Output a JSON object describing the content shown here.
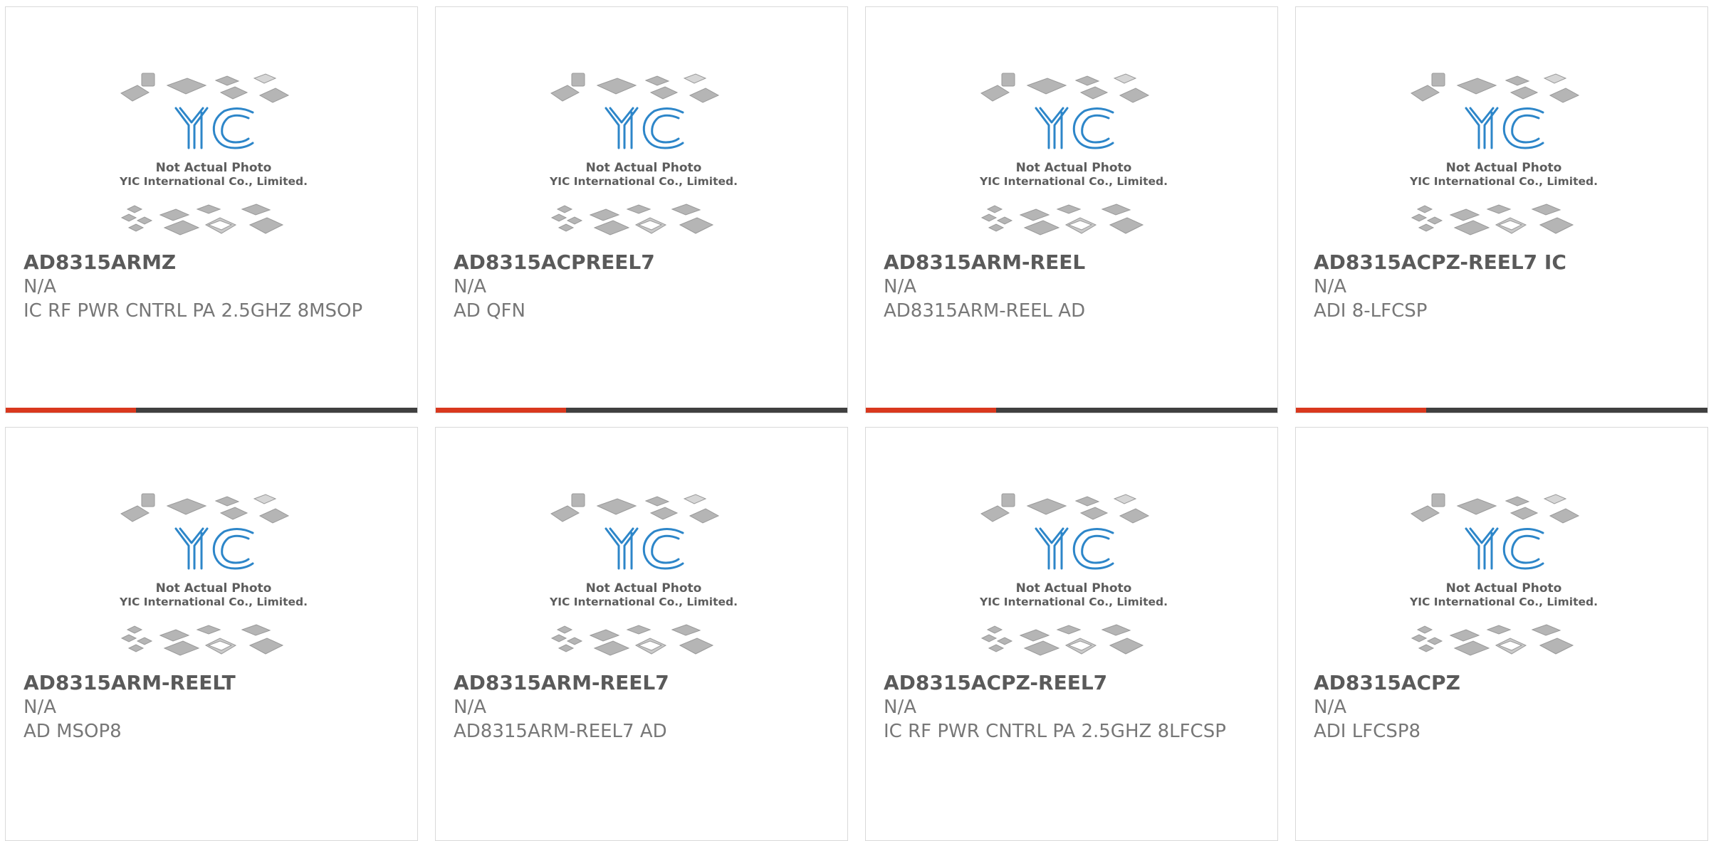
{
  "placeholder_image": {
    "line1": "Not Actual Photo",
    "line2": "YIC International Co., Limited.",
    "logo_text": "YIC"
  },
  "colors": {
    "accent": "#d9381e",
    "bar": "#404040",
    "logo": "#2d86c9"
  },
  "products": [
    {
      "part_number": "AD8315ARMZ",
      "manufacturer": "N/A",
      "description": "IC RF PWR CNTRL PA 2.5GHZ 8MSOP"
    },
    {
      "part_number": "AD8315ACPREEL7",
      "manufacturer": "N/A",
      "description": "AD QFN"
    },
    {
      "part_number": "AD8315ARM-REEL",
      "manufacturer": "N/A",
      "description": "AD8315ARM-REEL AD"
    },
    {
      "part_number": "AD8315ACPZ-REEL7 IC",
      "manufacturer": "N/A",
      "description": "ADI 8-LFCSP"
    },
    {
      "part_number": "AD8315ARM-REELT",
      "manufacturer": "N/A",
      "description": "AD MSOP8"
    },
    {
      "part_number": "AD8315ARM-REEL7",
      "manufacturer": "N/A",
      "description": "AD8315ARM-REEL7 AD"
    },
    {
      "part_number": "AD8315ACPZ-REEL7",
      "manufacturer": "N/A",
      "description": "IC RF PWR CNTRL PA 2.5GHZ 8LFCSP"
    },
    {
      "part_number": "AD8315ACPZ",
      "manufacturer": "N/A",
      "description": "ADI LFCSP8"
    }
  ]
}
